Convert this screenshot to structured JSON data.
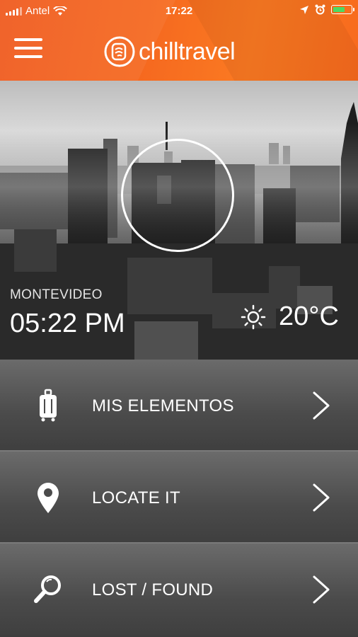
{
  "status_bar": {
    "carrier": "Antel",
    "time": "17:22"
  },
  "header": {
    "logo_text": "chilltravel",
    "brand_color": "#f5681f"
  },
  "hero": {
    "city": "MONTEVIDEO",
    "local_time": "05:22 PM",
    "weather_icon": "sun-icon",
    "temperature": "20°C"
  },
  "menu": {
    "items": [
      {
        "label": "MIS ELEMENTOS",
        "icon": "luggage-icon"
      },
      {
        "label": "LOCATE IT",
        "icon": "location-pin-icon"
      },
      {
        "label": "LOST / FOUND",
        "icon": "search-icon"
      }
    ]
  }
}
